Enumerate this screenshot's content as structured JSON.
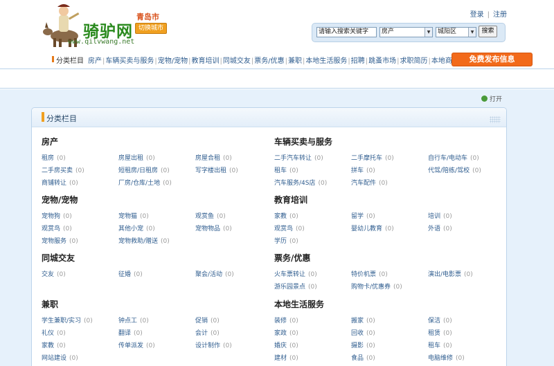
{
  "header": {
    "logo_text": "骑驴网",
    "logo_url": "www.qilvwang.net",
    "city": "青岛市",
    "switch_city": "切换城市",
    "login": "登录",
    "register": "注册"
  },
  "search": {
    "placeholder": "请输入搜索关键字",
    "category": "房产",
    "area": "城阳区",
    "button": "搜索"
  },
  "nav": {
    "title": "分类栏目",
    "items": [
      "房产",
      "车辆买卖与服务",
      "宠物/宠物",
      "教育培训",
      "同城交友",
      "票务/优惠",
      "兼职",
      "本地生活服务",
      "招聘",
      "跳蚤市场",
      "求职简历",
      "本地商务"
    ],
    "publish": "免费发布信息"
  },
  "open_link": "打开",
  "panel_title": "分类栏目",
  "sections": [
    {
      "title": "房产",
      "items": [
        {
          "name": "租房",
          "count": "(0)"
        },
        {
          "name": "房屋出租",
          "count": "(0)"
        },
        {
          "name": "房屋合租",
          "count": "(0)"
        },
        {
          "name": "二手房买卖",
          "count": "(0)"
        },
        {
          "name": "短租房/日租房",
          "count": "(0)"
        },
        {
          "name": "写字楼出租",
          "count": "(0)"
        },
        {
          "name": "商铺转让",
          "count": "(0)"
        },
        {
          "name": "厂房/仓库/土地",
          "count": "(0)"
        }
      ]
    },
    {
      "title": "车辆买卖与服务",
      "items": [
        {
          "name": "二手汽车转让",
          "count": "(0)"
        },
        {
          "name": "二手摩托车",
          "count": "(0)"
        },
        {
          "name": "自行车/电动车",
          "count": "(0)"
        },
        {
          "name": "租车",
          "count": "(0)"
        },
        {
          "name": "拼车",
          "count": "(0)"
        },
        {
          "name": "代驾/陪练/驾校",
          "count": "(0)"
        },
        {
          "name": "汽车服务/4S店",
          "count": "(0)"
        },
        {
          "name": "汽车配件",
          "count": "(0)"
        }
      ]
    },
    {
      "title": "宠物/宠物",
      "items": [
        {
          "name": "宠物狗",
          "count": "(0)"
        },
        {
          "name": "宠物猫",
          "count": "(0)"
        },
        {
          "name": "观赏鱼",
          "count": "(0)"
        },
        {
          "name": "观赏鸟",
          "count": "(0)"
        },
        {
          "name": "其他小宠",
          "count": "(0)"
        },
        {
          "name": "宠物物品",
          "count": "(0)"
        },
        {
          "name": "宠物服务",
          "count": "(0)"
        },
        {
          "name": "宠物救助/赠送",
          "count": "(0)"
        }
      ]
    },
    {
      "title": "教育培训",
      "items": [
        {
          "name": "家教",
          "count": "(0)"
        },
        {
          "name": "留学",
          "count": "(0)"
        },
        {
          "name": "培训",
          "count": "(0)"
        },
        {
          "name": "观赏鸟",
          "count": "(0)"
        },
        {
          "name": "婴幼儿教育",
          "count": "(0)"
        },
        {
          "name": "外语",
          "count": "(0)"
        },
        {
          "name": "学历",
          "count": "(0)"
        }
      ]
    },
    {
      "title": "同城交友",
      "items": [
        {
          "name": "交友",
          "count": "(0)"
        },
        {
          "name": "征婚",
          "count": "(0)"
        },
        {
          "name": "聚会/活动",
          "count": "(0)"
        }
      ]
    },
    {
      "title": "票务/优惠",
      "items": [
        {
          "name": "火车票转让",
          "count": "(0)"
        },
        {
          "name": "特价机票",
          "count": "(0)"
        },
        {
          "name": "演出/电影票",
          "count": "(0)"
        },
        {
          "name": "游乐园景点",
          "count": "(0)"
        },
        {
          "name": "购物卡/优惠券",
          "count": "(0)"
        }
      ]
    },
    {
      "title": "兼职",
      "items": [
        {
          "name": "学生兼职/实习",
          "count": "(0)"
        },
        {
          "name": "钟点工",
          "count": "(0)"
        },
        {
          "name": "促销",
          "count": "(0)"
        },
        {
          "name": "礼仪",
          "count": "(0)"
        },
        {
          "name": "翻译",
          "count": "(0)"
        },
        {
          "name": "会计",
          "count": "(0)"
        },
        {
          "name": "家教",
          "count": "(0)"
        },
        {
          "name": "传单派发",
          "count": "(0)"
        },
        {
          "name": "设计制作",
          "count": "(0)"
        },
        {
          "name": "网站建设",
          "count": "(0)"
        }
      ]
    },
    {
      "title": "本地生活服务",
      "items": [
        {
          "name": "装修",
          "count": "(0)"
        },
        {
          "name": "搬家",
          "count": "(0)"
        },
        {
          "name": "保洁",
          "count": "(0)"
        },
        {
          "name": "家政",
          "count": "(0)"
        },
        {
          "name": "回收",
          "count": "(0)"
        },
        {
          "name": "租赁",
          "count": "(0)"
        },
        {
          "name": "婚庆",
          "count": "(0)"
        },
        {
          "name": "摄影",
          "count": "(0)"
        },
        {
          "name": "租车",
          "count": "(0)"
        },
        {
          "name": "建材",
          "count": "(0)"
        },
        {
          "name": "食品",
          "count": "(0)"
        },
        {
          "name": "电脑维修",
          "count": "(0)"
        }
      ]
    }
  ]
}
